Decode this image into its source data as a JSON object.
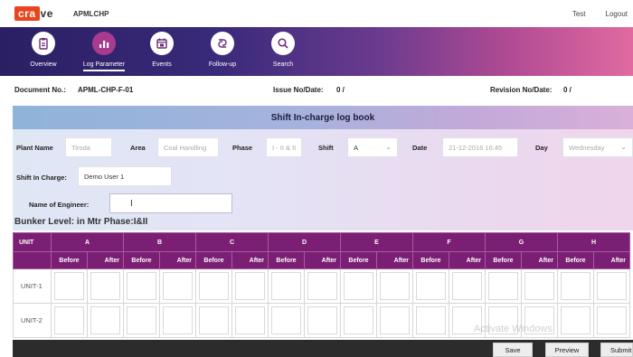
{
  "top": {
    "logo_colored": "cra",
    "logo_rest": "ve",
    "app_name": "APMLCHP",
    "user": "Test",
    "logout": "Logout"
  },
  "nav": {
    "items": [
      {
        "label": "Overview",
        "icon": "clipboard-icon"
      },
      {
        "label": "Log Parameter",
        "icon": "bar-chart-icon"
      },
      {
        "label": "Events",
        "icon": "calendar-icon"
      },
      {
        "label": "Follow-up",
        "icon": "follow-up-icon"
      },
      {
        "label": "Search",
        "icon": "search-icon"
      }
    ],
    "active_index": 1
  },
  "document": {
    "doc_no_label": "Document No.:",
    "doc_no_value": "APML-CHP-F-01",
    "issue_label": "Issue No/Date:",
    "issue_value": "0 /",
    "revision_label": "Revision No/Date:",
    "revision_value": "0 /"
  },
  "title": "Shift In-charge log book",
  "form": {
    "plant_label": "Plant Name",
    "plant_value": "Tiroda",
    "area_label": "Area",
    "area_value": "Coal Handling",
    "phase_label": "Phase",
    "phase_value": "I - II & II",
    "shift_label": "Shift",
    "shift_value": "A",
    "date_label": "Date",
    "date_value": "21-12-2016 16:45",
    "day_label": "Day",
    "day_value": "Wednesday",
    "incharge_label": "Shift In Charge:",
    "incharge_value": "Demo User 1",
    "engineer_label": "Name of Engineer:",
    "engineer_value": ""
  },
  "bunker_heading": "Bunker Level: in Mtr Phase:I&II",
  "table": {
    "unit_header": "UNIT",
    "groups": [
      "A",
      "B",
      "C",
      "D",
      "E",
      "F",
      "G",
      "H"
    ],
    "sub_before": "Before",
    "sub_after": "After",
    "rows": [
      "UNIT-1",
      "UNIT-2"
    ]
  },
  "footer": {
    "save": "Save",
    "preview": "Preview",
    "submit": "Submit",
    "watermark": "Activate Windows"
  },
  "colors": {
    "logo_orange": "#e8441d",
    "nav_start": "#2a1f63",
    "nav_end": "#e06aa0",
    "table_header": "#7a1f74"
  }
}
